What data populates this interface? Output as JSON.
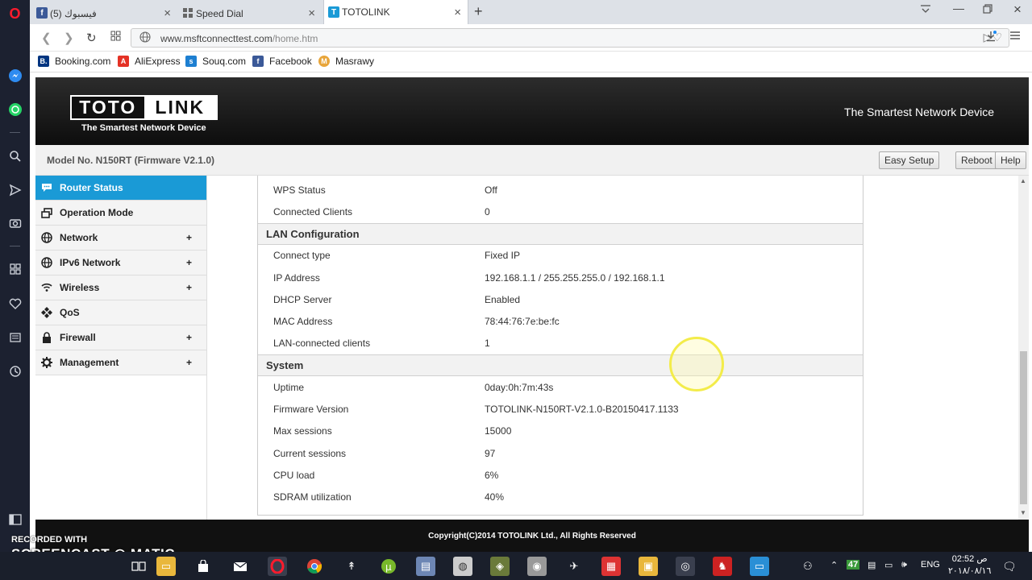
{
  "browser": {
    "tabs": [
      {
        "label": "(5) فيسبوك",
        "icon": "facebook-icon",
        "color": "#3b5998"
      },
      {
        "label": "Speed Dial",
        "icon": "speed-dial-icon",
        "color": "#888888"
      },
      {
        "label": "TOTOLINK",
        "icon": "totolink-icon",
        "color": "#1a9ad6"
      }
    ],
    "url_host": "www.msftconnecttest.com",
    "url_path": "/home.htm",
    "bookmarks": [
      {
        "label": "Booking.com",
        "color": "#003580",
        "glyph": "B."
      },
      {
        "label": "AliExpress",
        "color": "#e43225",
        "glyph": "A"
      },
      {
        "label": "Souq.com",
        "color": "#1d7fd1",
        "glyph": "s"
      },
      {
        "label": "Facebook",
        "color": "#3b5998",
        "glyph": "f"
      },
      {
        "label": "Masrawy",
        "color": "#e8a53a",
        "glyph": "M"
      }
    ]
  },
  "router": {
    "logo_left": "TOTO",
    "logo_right": "LINK",
    "logo_sub": "The Smartest Network Device",
    "tagline": "The Smartest Network Device",
    "model": "Model No. N150RT (Firmware V2.1.0)",
    "buttons": {
      "easy_setup": "Easy Setup",
      "reboot": "Reboot",
      "help": "Help"
    },
    "menu": [
      {
        "label": "Router Status",
        "icon": "chat-icon",
        "expandable": false,
        "active": true
      },
      {
        "label": "Operation Mode",
        "icon": "windows-icon",
        "expandable": false,
        "active": false
      },
      {
        "label": "Network",
        "icon": "globe-icon",
        "expandable": true,
        "active": false
      },
      {
        "label": "IPv6 Network",
        "icon": "globe-icon",
        "expandable": true,
        "active": false
      },
      {
        "label": "Wireless",
        "icon": "wifi-icon",
        "expandable": true,
        "active": false
      },
      {
        "label": "QoS",
        "icon": "qos-icon",
        "expandable": false,
        "active": false
      },
      {
        "label": "Firewall",
        "icon": "lock-icon",
        "expandable": true,
        "active": false
      },
      {
        "label": "Management",
        "icon": "gear-icon",
        "expandable": true,
        "active": false
      }
    ],
    "plus": "+",
    "wireless_rows": [
      {
        "label": "WPS Status",
        "value": "Off"
      },
      {
        "label": "Connected Clients",
        "value": "0"
      }
    ],
    "lan_title": "LAN Configuration",
    "lan_rows": [
      {
        "label": "Connect type",
        "value": "Fixed IP"
      },
      {
        "label": "IP Address",
        "value": "192.168.1.1 / 255.255.255.0 / 192.168.1.1"
      },
      {
        "label": "DHCP Server",
        "value": "Enabled"
      },
      {
        "label": "MAC Address",
        "value": "78:44:76:7e:be:fc"
      },
      {
        "label": "LAN-connected clients",
        "value": "1"
      }
    ],
    "system_title": "System",
    "system_rows": [
      {
        "label": "Uptime",
        "value": "0day:0h:7m:43s"
      },
      {
        "label": "Firmware Version",
        "value": "TOTOLINK-N150RT-V2.1.0-B20150417.1133"
      },
      {
        "label": "Max sessions",
        "value": "15000"
      },
      {
        "label": "Current sessions",
        "value": "97"
      },
      {
        "label": "CPU load",
        "value": "6%"
      },
      {
        "label": "SDRAM utilization",
        "value": "40%"
      }
    ],
    "footer": "Copyright(C)2014 TOTOLINK Ltd., All Rights Reserved"
  },
  "taskbar": {
    "battery": "47",
    "lang": "ENG",
    "time": "02:52 ص",
    "date": "٢٠١٨/٠٨/١٦"
  },
  "watermark": {
    "line1": "RECORDED WITH",
    "line2": "SCREENCAST",
    "line3": "MATIC"
  }
}
